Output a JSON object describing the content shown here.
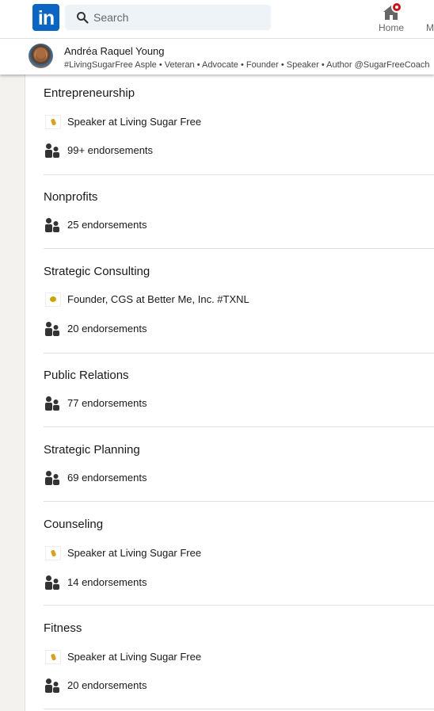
{
  "nav": {
    "logo_text": "in",
    "search_placeholder": "Search",
    "home_label": "Home",
    "next_label": "M",
    "brand_color": "#0a66c2"
  },
  "profile": {
    "name": "Andréa Raquel Young",
    "headline": "#LivingSugarFree Asple • Veteran • Advocate • Founder • Speaker • Author @SugarFreeCoach"
  },
  "skills": [
    {
      "name": "Entrepreneurship",
      "context": "Speaker at Living Sugar Free",
      "context_logo": "living-sugar-free-logo",
      "endorsements": "99+ endorsements"
    },
    {
      "name": "Nonprofits",
      "endorsements": "25 endorsements"
    },
    {
      "name": "Strategic Consulting",
      "context": "Founder, CGS at Better Me, Inc. #TXNL",
      "context_logo": "better-me-logo",
      "endorsements": "20 endorsements"
    },
    {
      "name": "Public Relations",
      "endorsements": "77 endorsements"
    },
    {
      "name": "Strategic Planning",
      "endorsements": "69 endorsements"
    },
    {
      "name": "Counseling",
      "context": "Speaker at Living Sugar Free",
      "context_logo": "living-sugar-free-logo",
      "endorsements": "14 endorsements"
    },
    {
      "name": "Fitness",
      "context": "Speaker at Living Sugar Free",
      "context_logo": "living-sugar-free-logo",
      "endorsements": "20 endorsements"
    }
  ]
}
